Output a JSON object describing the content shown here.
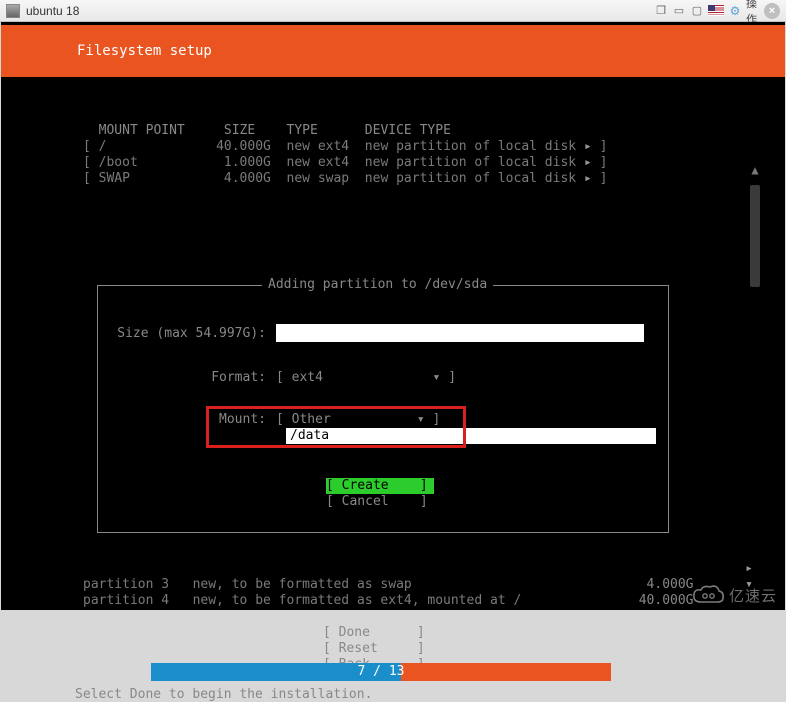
{
  "vm": {
    "title": "ubuntu 18",
    "action_label": "操作"
  },
  "header": {
    "title": "Filesystem setup"
  },
  "table": {
    "headers": {
      "mount": "MOUNT POINT",
      "size": "SIZE",
      "type": "TYPE",
      "devtype": "DEVICE TYPE"
    },
    "rows": [
      {
        "mount": "/",
        "size": "40.000G",
        "type": "new ext4",
        "devtype": "new partition of local disk"
      },
      {
        "mount": "/boot",
        "size": "1.000G",
        "type": "new ext4",
        "devtype": "new partition of local disk"
      },
      {
        "mount": "SWAP",
        "size": "4.000G",
        "type": "new swap",
        "devtype": "new partition of local disk"
      }
    ]
  },
  "dialog": {
    "title": "Adding partition to /dev/sda",
    "size_label": "Size (max 54.997G):",
    "format_label": "Format:",
    "format_value": "ext4",
    "mount_label": "Mount:",
    "mount_selected": "Other",
    "mount_value": "/data",
    "create_label": "Create",
    "cancel_label": "Cancel"
  },
  "summary": {
    "lines": [
      {
        "label": "partition 3",
        "desc": "new, to be formatted as swap",
        "size": "4.000G"
      },
      {
        "label": "partition 4",
        "desc": "new, to be formatted as ext4, mounted at /",
        "size": "40.000G"
      }
    ]
  },
  "bottom_menu": {
    "done": "Done",
    "reset": "Reset",
    "back": "Back"
  },
  "progress": {
    "text": "7 / 13"
  },
  "footer": {
    "help": "Select Done to begin the installation."
  },
  "watermark": {
    "text": "亿速云"
  }
}
